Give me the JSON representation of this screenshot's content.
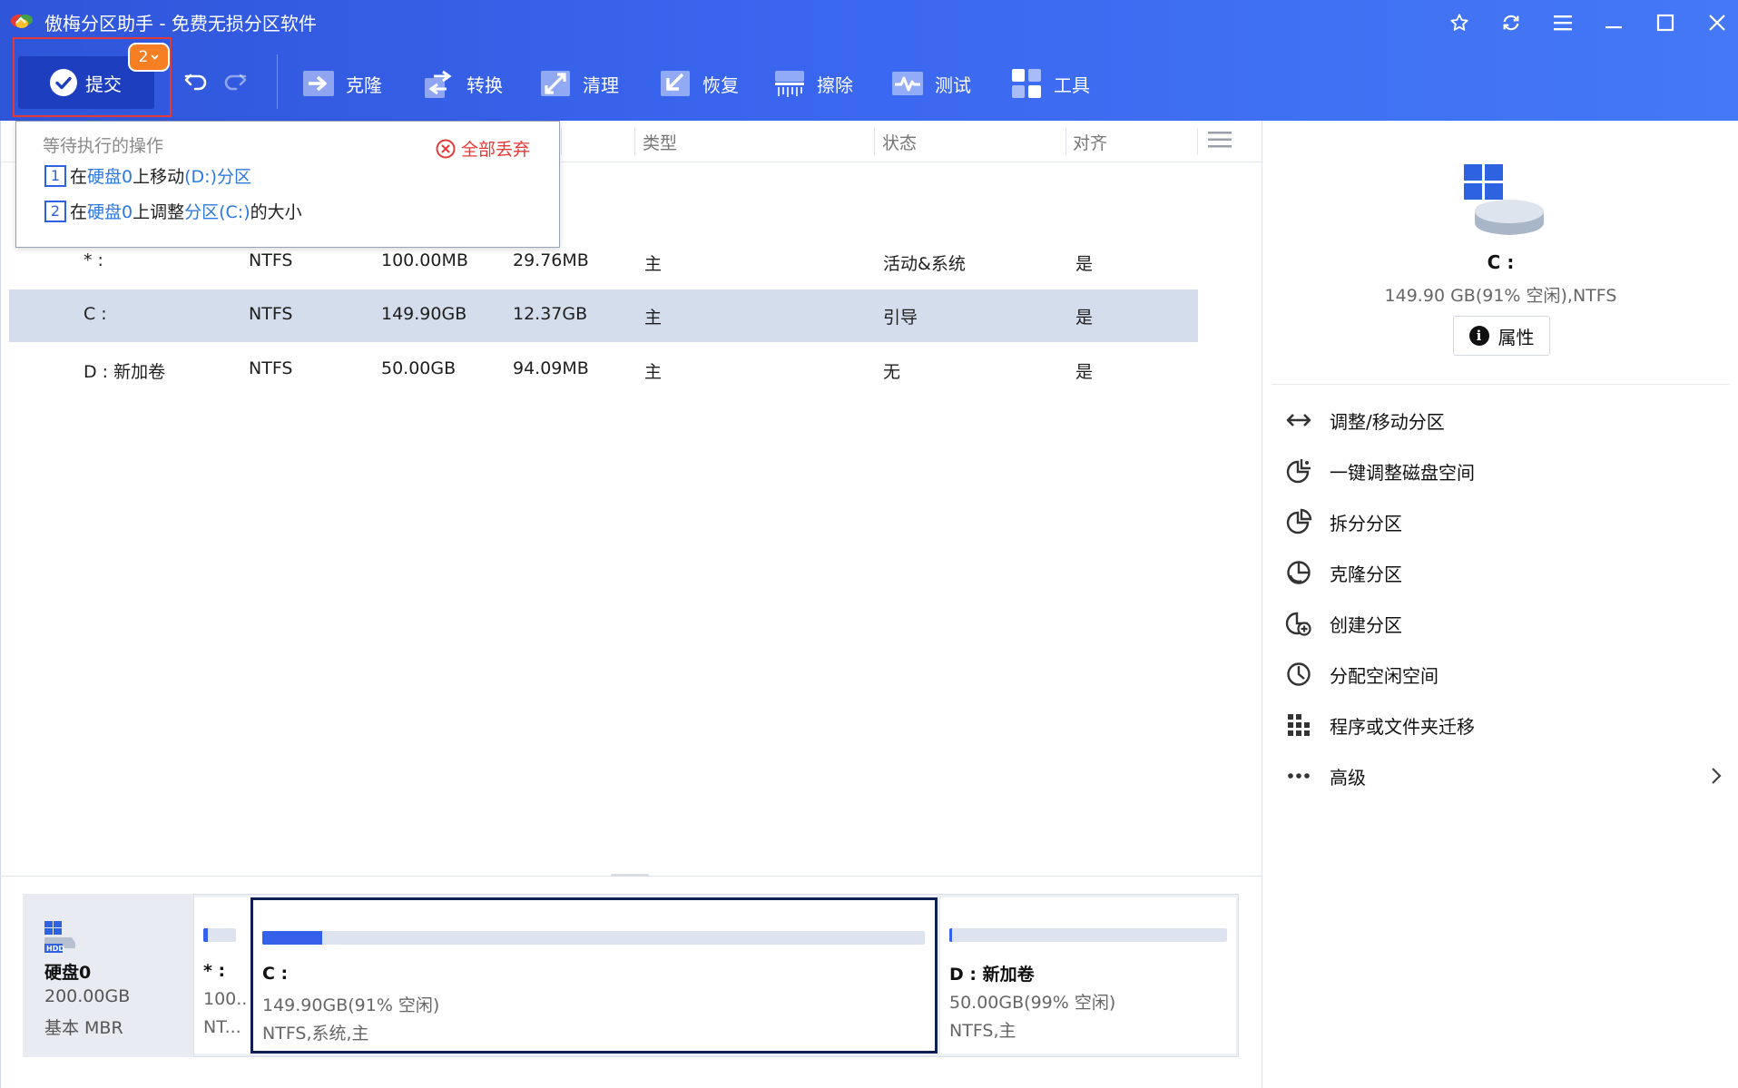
{
  "app": {
    "title": "傲梅分区助手 - 免费无损分区软件"
  },
  "window_controls": [
    "star-icon",
    "refresh-icon",
    "menu-icon",
    "minimize-icon",
    "maximize-icon",
    "close-icon"
  ],
  "toolbar": {
    "commit_label": "提交",
    "commit_badge": "2",
    "tools": [
      {
        "label": "克隆",
        "icon": "clone-icon"
      },
      {
        "label": "转换",
        "icon": "convert-icon"
      },
      {
        "label": "清理",
        "icon": "cleanup-icon"
      },
      {
        "label": "恢复",
        "icon": "recover-icon"
      },
      {
        "label": "擦除",
        "icon": "wipe-icon"
      },
      {
        "label": "测试",
        "icon": "test-icon"
      },
      {
        "label": "工具",
        "icon": "tools-icon"
      }
    ]
  },
  "pending": {
    "title": "等待执行的操作",
    "discard_all": "全部丢弃",
    "ops": [
      {
        "num": "1",
        "p1": "在",
        "p2": "硬盘0",
        "p3": "上移动",
        "p4": "(D:)分区",
        "p5": ""
      },
      {
        "num": "2",
        "p1": "在",
        "p2": "硬盘0",
        "p3": "上调整",
        "p4": "分区(C:)",
        "p5": "的大小"
      }
    ]
  },
  "table": {
    "headers": [
      "类型",
      "状态",
      "对齐"
    ],
    "rows": [
      {
        "name": "* :",
        "fs": "NTFS",
        "capacity": "100.00MB",
        "free": "29.76MB",
        "type": "主",
        "status": "活动&系统",
        "aligned": "是"
      },
      {
        "name": "C :",
        "fs": "NTFS",
        "capacity": "149.90GB",
        "free": "12.37GB",
        "type": "主",
        "status": "引导",
        "aligned": "是"
      },
      {
        "name": "D : 新加卷",
        "fs": "NTFS",
        "capacity": "50.00GB",
        "free": "94.09MB",
        "type": "主",
        "status": "无",
        "aligned": "是"
      }
    ]
  },
  "disk": {
    "name": "硬盘0",
    "size": "200.00GB",
    "type": "基本 MBR",
    "icon_label": "HDD",
    "partitions": [
      {
        "name": "* :",
        "line1": "100...",
        "line2": "NT...",
        "used_fraction": 0.15
      },
      {
        "name": "C :",
        "line1": "149.90GB(91% 空闲)",
        "line2": "NTFS,系统,主",
        "used_fraction": 0.09
      },
      {
        "name": "D : 新加卷",
        "line1": "50.00GB(99% 空闲)",
        "line2": "NTFS,主",
        "used_fraction": 0.01
      }
    ]
  },
  "panel": {
    "name": "C :",
    "detail": "149.90 GB(91% 空闲),NTFS",
    "properties": "属性",
    "actions": [
      {
        "label": "调整/移动分区",
        "icon": "resize-move-icon"
      },
      {
        "label": "一键调整磁盘空间",
        "icon": "one-click-adjust-icon"
      },
      {
        "label": "拆分分区",
        "icon": "split-partition-icon"
      },
      {
        "label": "克隆分区",
        "icon": "clone-partition-icon"
      },
      {
        "label": "创建分区",
        "icon": "create-partition-icon"
      },
      {
        "label": "分配空闲空间",
        "icon": "allocate-space-icon"
      },
      {
        "label": "程序或文件夹迁移",
        "icon": "app-mover-icon"
      },
      {
        "label": "高级",
        "icon": "more-icon"
      }
    ]
  },
  "colors": {
    "accent": "#2d63e0",
    "header": "#3a66ef",
    "selected_row": "#d3ddec",
    "danger": "#e53935",
    "badge": "#f57f22"
  }
}
